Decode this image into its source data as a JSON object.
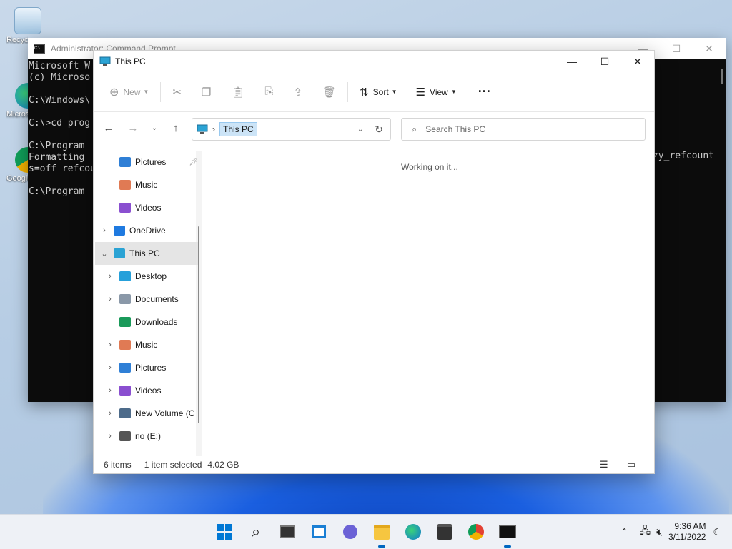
{
  "desktop": {
    "icons": [
      {
        "label": "Recycle Bin"
      },
      {
        "label": "Microsoft Edge"
      },
      {
        "label": "Google Chrome"
      }
    ]
  },
  "cmd": {
    "title": "Administrator: Command Prompt",
    "lines": [
      "Microsoft W",
      "(c) Microso",
      "",
      "C:\\Windows\\",
      "",
      "C:\\>cd prog",
      "",
      "C:\\Program ",
      "Formatting ",
      "s=off refcou",
      "",
      "C:\\Program "
    ],
    "right_text": "zy_refcount"
  },
  "explorer": {
    "title": "This PC",
    "toolbar": {
      "new": "New",
      "sort": "Sort",
      "view": "View",
      "more": "···"
    },
    "address": {
      "crumb": "This PC"
    },
    "search": {
      "placeholder": "Search This PC"
    },
    "nav_items": [
      {
        "label": "Pictures",
        "indent": 1,
        "chev": "",
        "color": "#2f7fd6",
        "pinned": true
      },
      {
        "label": "Music",
        "indent": 1,
        "chev": "",
        "color": "#e07a54"
      },
      {
        "label": "Videos",
        "indent": 1,
        "chev": "",
        "color": "#8a4fd0"
      },
      {
        "label": "OneDrive",
        "indent": 0,
        "chev": "›",
        "color": "#1f7ae0"
      },
      {
        "label": "This PC",
        "indent": 0,
        "chev": "⌄",
        "color": "#2ba3d4",
        "selected": true
      },
      {
        "label": "Desktop",
        "indent": 1,
        "chev": "›",
        "color": "#26a0da"
      },
      {
        "label": "Documents",
        "indent": 1,
        "chev": "›",
        "color": "#8a98a8"
      },
      {
        "label": "Downloads",
        "indent": 1,
        "chev": "",
        "color": "#1a9a5a"
      },
      {
        "label": "Music",
        "indent": 1,
        "chev": "›",
        "color": "#e07a54"
      },
      {
        "label": "Pictures",
        "indent": 1,
        "chev": "›",
        "color": "#2f7fd6"
      },
      {
        "label": "Videos",
        "indent": 1,
        "chev": "›",
        "color": "#8a4fd0"
      },
      {
        "label": "New Volume (C",
        "indent": 1,
        "chev": "›",
        "color": "#4d6b8a"
      },
      {
        "label": "no (E:)",
        "indent": 1,
        "chev": "›",
        "color": "#555555"
      }
    ],
    "content": {
      "working": "Working on it..."
    },
    "status": {
      "items": "6 items",
      "selected": "1 item selected",
      "size": "4.02 GB"
    }
  },
  "taskbar": {
    "time": "9:36 AM",
    "date": "3/11/2022"
  },
  "colors": {
    "accent": "#0067c0",
    "selection": "#cce4f7"
  }
}
